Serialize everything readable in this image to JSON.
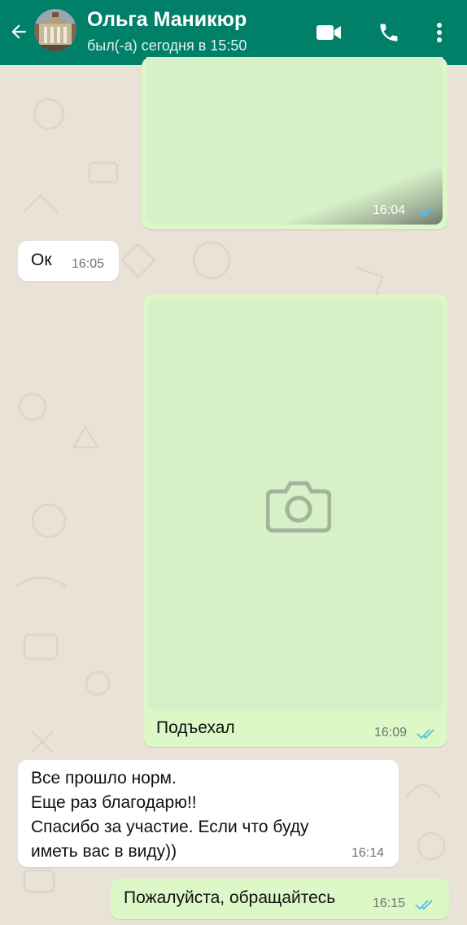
{
  "header": {
    "contact_name": "Ольга Маникюр",
    "status": "был(-а) сегодня в 15:50",
    "color": "#008069"
  },
  "icons": {
    "back": "arrow-left-icon",
    "video": "video-camera-icon",
    "call": "phone-icon",
    "menu": "more-vertical-icon",
    "photo_placeholder": "camera-icon",
    "read_receipt": "double-check-icon"
  },
  "messages": [
    {
      "direction": "outgoing",
      "type": "image",
      "caption": "",
      "time": "16:04",
      "status": "read"
    },
    {
      "direction": "incoming",
      "type": "text",
      "text": "Ок",
      "time": "16:05"
    },
    {
      "direction": "outgoing",
      "type": "image",
      "caption": "Подъехал",
      "time": "16:09",
      "status": "read"
    },
    {
      "direction": "incoming",
      "type": "text",
      "lines": [
        "Все прошло норм.",
        "Еще раз благодарю!!",
        "Спасибо за участие. Если что буду",
        "иметь вас в виду))"
      ],
      "time": "16:14"
    },
    {
      "direction": "outgoing",
      "type": "text",
      "text": "Пожалуйста, обращайтесь",
      "time": "16:15",
      "status": "read"
    }
  ],
  "colors": {
    "outgoing_bubble": "#dcf8c6",
    "incoming_bubble": "#ffffff",
    "read_tick": "#53bdeb",
    "wallpaper": "#e9e2d7"
  }
}
